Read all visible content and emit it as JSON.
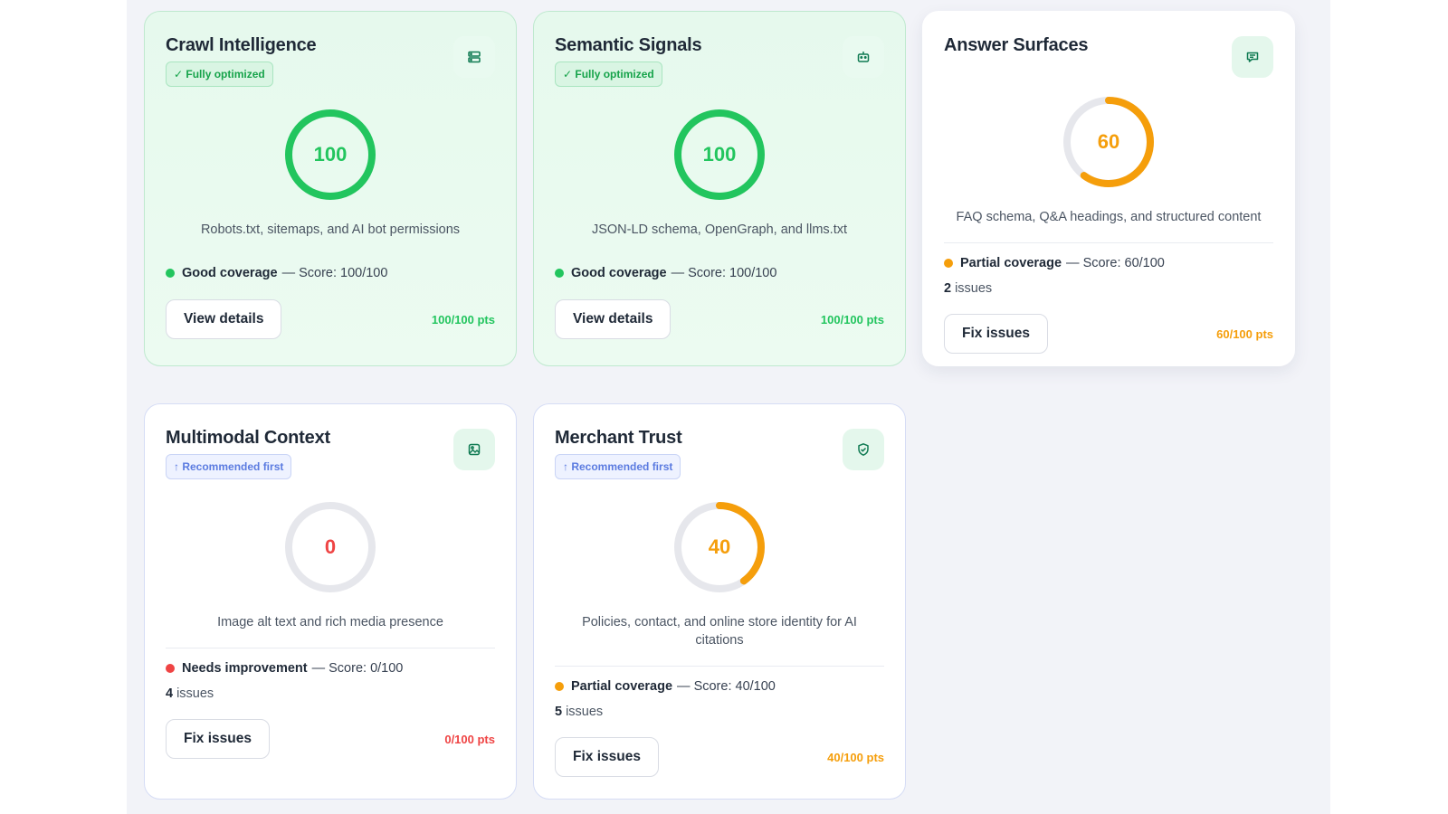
{
  "colors": {
    "green": "#22c55e",
    "orange": "#f59e0b",
    "red": "#ef4444",
    "track": "#e6e7ec",
    "icon": "#0f7a52"
  },
  "cards": [
    {
      "title": "Crawl Intelligence",
      "badge": "✓ Fully optimized",
      "icon": "server-icon",
      "score": 100,
      "score_label": "100",
      "description": "Robots.txt, sitemaps, and AI bot permissions",
      "status_label": "Good coverage",
      "status_detail": "— Score: 100/100",
      "button": "View details",
      "points": "100/100 pts"
    },
    {
      "title": "Semantic Signals",
      "badge": "✓ Fully optimized",
      "icon": "robot-icon",
      "score": 100,
      "score_label": "100",
      "description": "JSON-LD schema, OpenGraph, and llms.txt",
      "status_label": "Good coverage",
      "status_detail": "— Score: 100/100",
      "button": "View details",
      "points": "100/100 pts"
    },
    {
      "title": "Answer Surfaces",
      "icon": "chat-icon",
      "score": 60,
      "score_label": "60",
      "description": "FAQ schema, Q&A headings, and structured content",
      "status_label": "Partial coverage",
      "status_detail": "— Score: 60/100",
      "issues_count": "2",
      "issues_word": "issues",
      "button": "Fix issues",
      "points": "60/100 pts"
    },
    {
      "title": "Multimodal Context",
      "badge": "↑ Recommended first",
      "icon": "image-icon",
      "score": 0,
      "score_label": "0",
      "description": "Image alt text and rich media presence",
      "status_label": "Needs improvement",
      "status_detail": "— Score: 0/100",
      "issues_count": "4",
      "issues_word": "issues",
      "button": "Fix issues",
      "points": "0/100 pts"
    },
    {
      "title": "Merchant Trust",
      "badge": "↑ Recommended first",
      "icon": "shield-check-icon",
      "score": 40,
      "score_label": "40",
      "description": "Policies, contact, and online store identity for AI citations",
      "status_label": "Partial coverage",
      "status_detail": "— Score: 40/100",
      "issues_count": "5",
      "issues_word": "issues",
      "button": "Fix issues",
      "points": "40/100 pts"
    }
  ]
}
